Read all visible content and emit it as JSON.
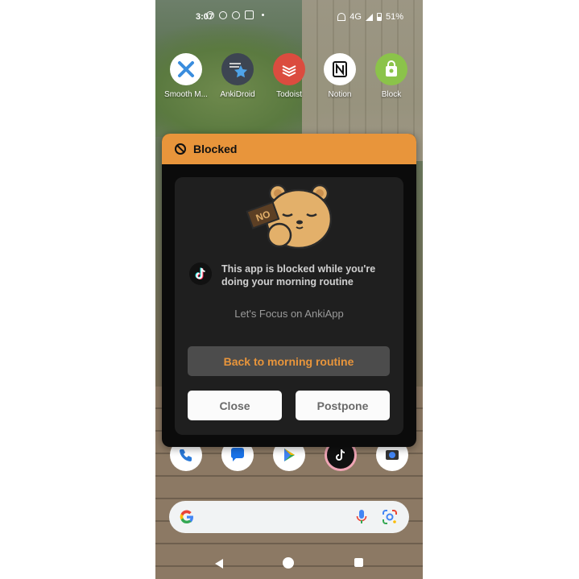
{
  "status_bar": {
    "time": "3:07",
    "network": "4G",
    "battery": "51%"
  },
  "home_apps": [
    {
      "label": "Smooth M...",
      "icon": "smooth-icon"
    },
    {
      "label": "AnkiDroid",
      "icon": "ankidroid-icon"
    },
    {
      "label": "Todoist",
      "icon": "todoist-icon"
    },
    {
      "label": "Notion",
      "icon": "notion-icon"
    },
    {
      "label": "Block",
      "icon": "block-icon"
    }
  ],
  "dialog": {
    "title": "Blocked",
    "message": "This app is blocked while you're doing your morning routine",
    "focus_text": "Let's Focus on AnkiApp",
    "back_label": "Back to morning routine",
    "close_label": "Close",
    "postpone_label": "Postpone",
    "sign_text": "NO",
    "accent_color": "#e8953b"
  }
}
